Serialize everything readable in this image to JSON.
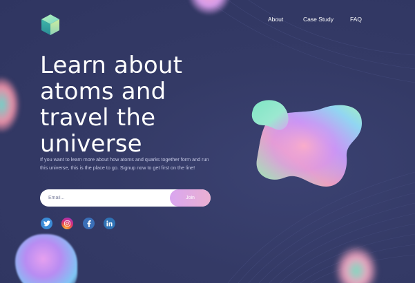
{
  "nav": {
    "items": [
      {
        "label": "About"
      },
      {
        "label": "Case Study"
      },
      {
        "label": "FAQ"
      }
    ]
  },
  "hero": {
    "title_lines": [
      "Learn about",
      "atoms and",
      "travel the",
      "universe"
    ],
    "description": "If you want to learn more about how atoms and quarks together form and run this universe, this is the place to go. Signup now to get first on the line!"
  },
  "signup": {
    "email_placeholder": "Email...",
    "join_label": "Join"
  },
  "social": [
    "twitter-icon",
    "instagram-icon",
    "facebook-icon",
    "linkedin-icon"
  ],
  "colors": {
    "background": "#343a66",
    "join_button": "#e0abe6",
    "text_muted": "#c4c7e3"
  }
}
